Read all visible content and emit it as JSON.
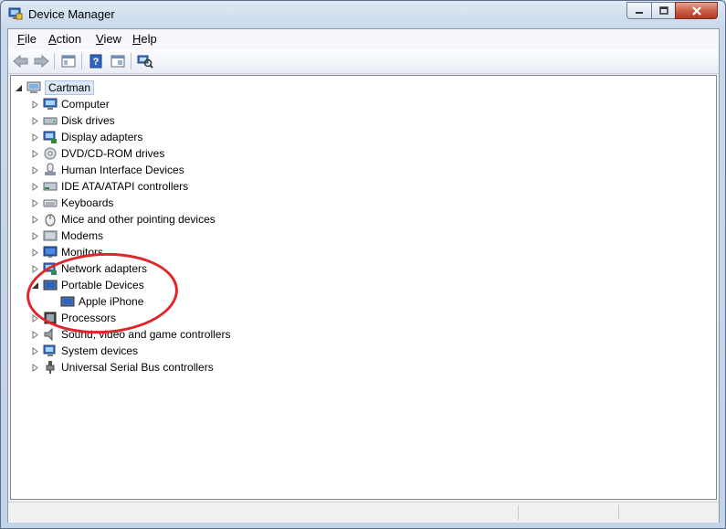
{
  "window": {
    "title": "Device Manager"
  },
  "menu": [
    {
      "label_u": "F",
      "label_rest": "ile"
    },
    {
      "label_u": "A",
      "label_rest": "ction"
    },
    {
      "label_u": "V",
      "label_rest": "iew"
    },
    {
      "label_u": "H",
      "label_rest": "elp"
    }
  ],
  "toolbar": {
    "icons": [
      "back-arrow-icon",
      "forward-arrow-icon",
      "properties-sheet-icon",
      "help-icon",
      "show-hide-console-icon",
      "scan-hardware-icon"
    ]
  },
  "tree": {
    "root": "Cartman",
    "categories": [
      "Computer",
      "Disk drives",
      "Display adapters",
      "DVD/CD-ROM drives",
      "Human Interface Devices",
      "IDE ATA/ATAPI controllers",
      "Keyboards",
      "Mice and other pointing devices",
      "Modems",
      "Monitors",
      "Network adapters",
      "Portable Devices",
      "Processors",
      "Sound, video and game controllers",
      "System devices",
      "Universal Serial Bus controllers"
    ],
    "portable_child": "Apple iPhone"
  },
  "colors": {
    "annotation": "#e0262b",
    "selection": "#dde8f7"
  }
}
